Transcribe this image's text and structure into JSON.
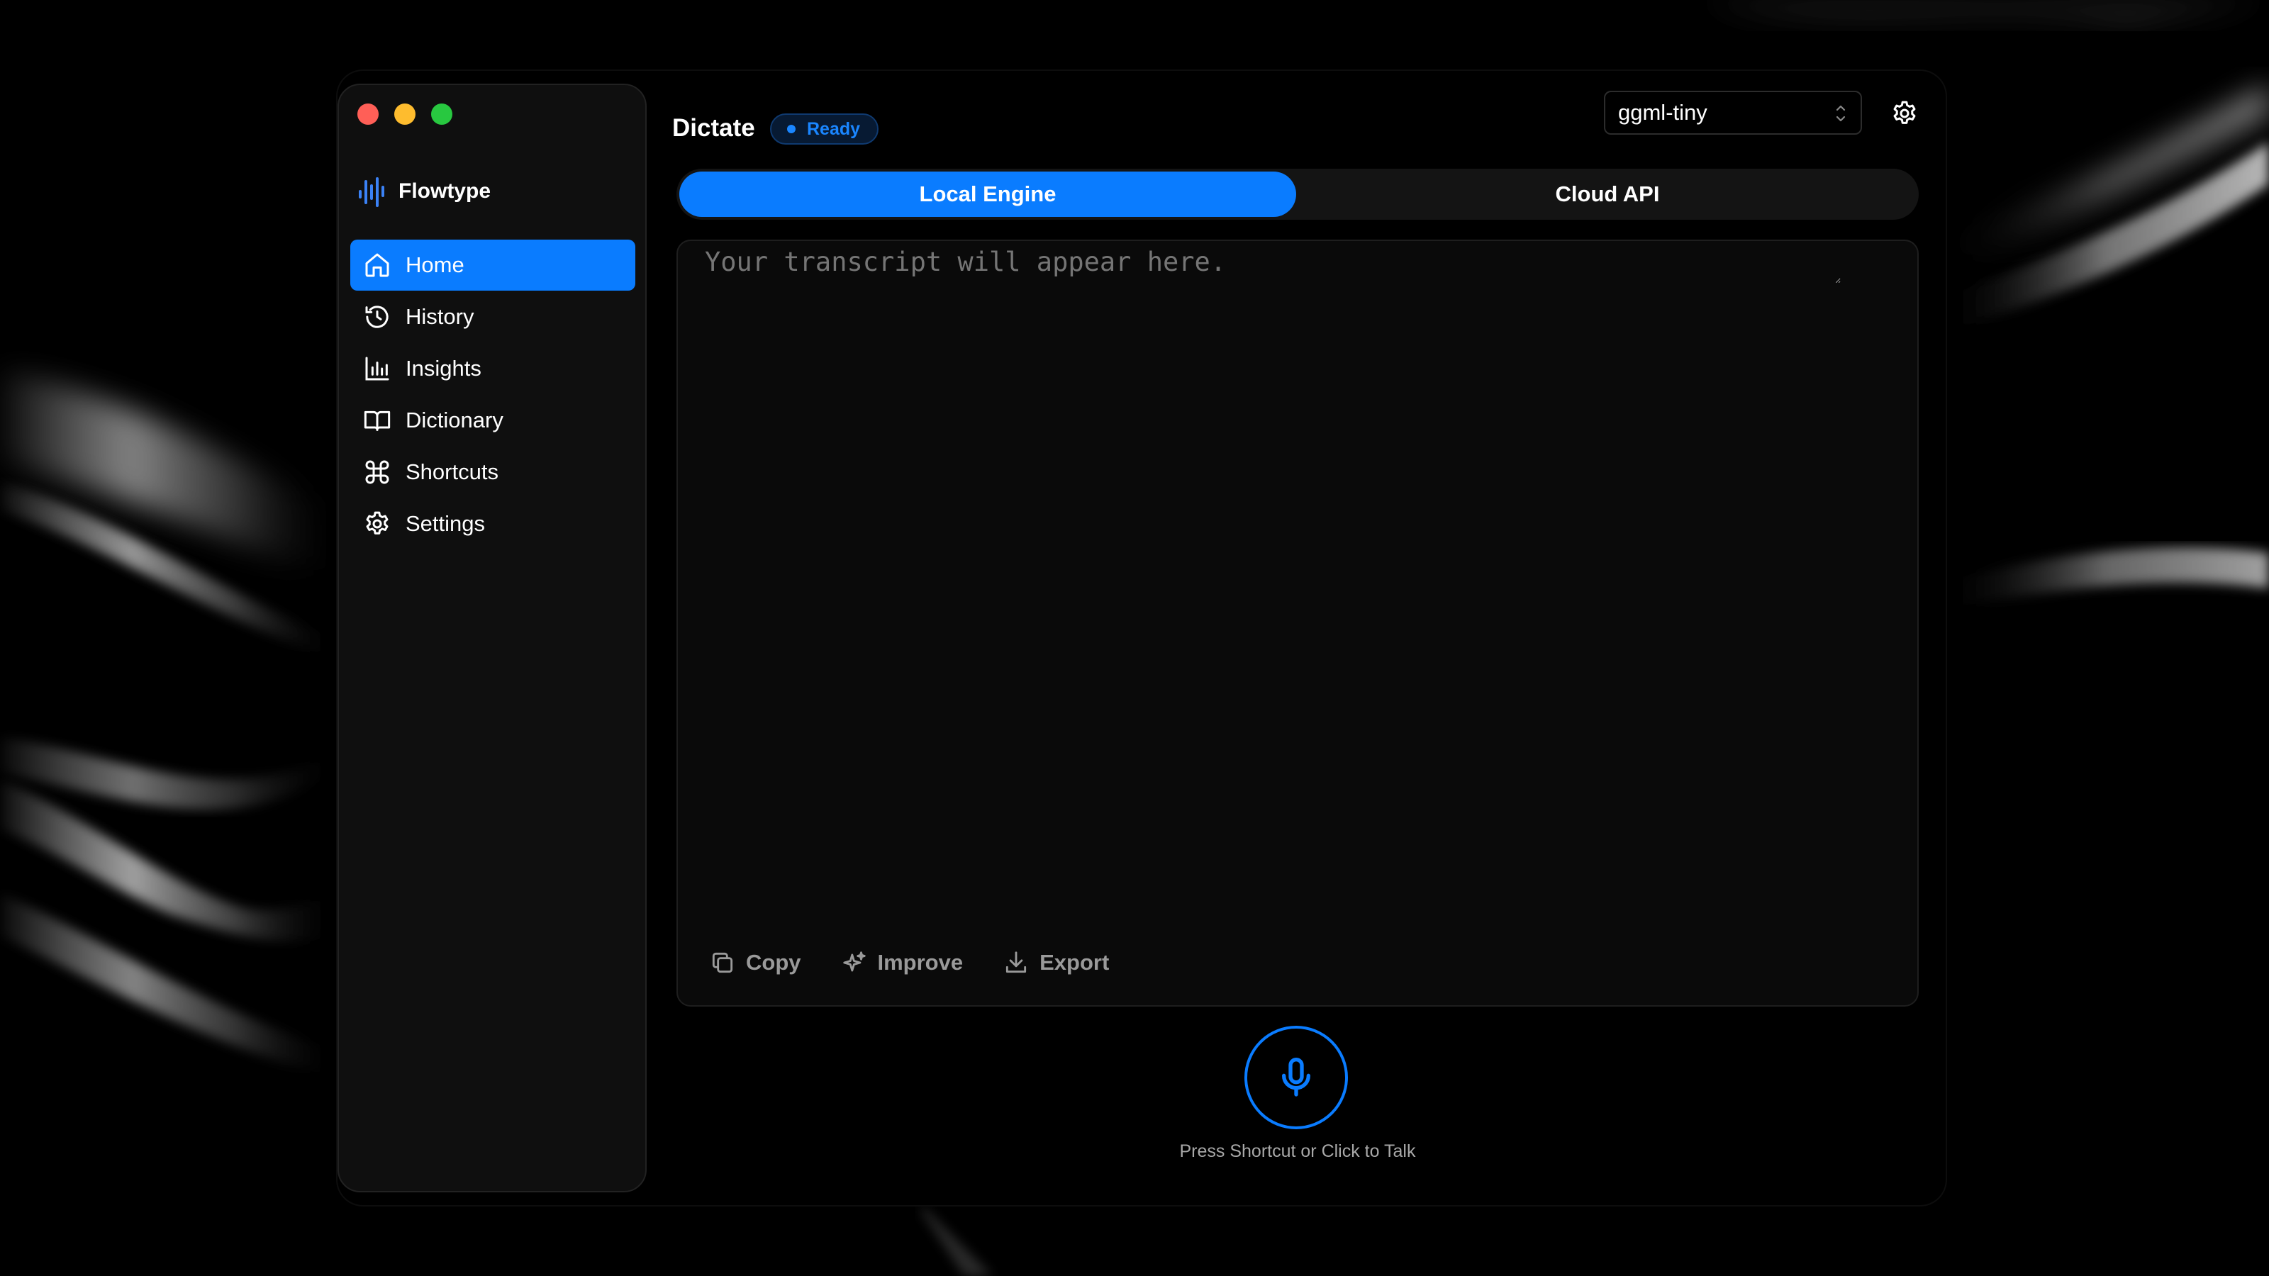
{
  "window": {
    "traffic_lights": {
      "close_color": "#ff5f57",
      "minimize_color": "#febc2e",
      "zoom_color": "#28c840"
    }
  },
  "sidebar": {
    "brand": {
      "name": "Flowtype",
      "icon": "waveform-icon"
    },
    "items": [
      {
        "label": "Home",
        "icon": "home-icon",
        "active": true
      },
      {
        "label": "History",
        "icon": "history-icon",
        "active": false
      },
      {
        "label": "Insights",
        "icon": "bar-chart-icon",
        "active": false
      },
      {
        "label": "Dictionary",
        "icon": "book-icon",
        "active": false
      },
      {
        "label": "Shortcuts",
        "icon": "command-icon",
        "active": false
      },
      {
        "label": "Settings",
        "icon": "gear-icon",
        "active": false
      }
    ]
  },
  "header": {
    "title": "Dictate",
    "status": "Ready",
    "model_select": {
      "value": "ggml-tiny"
    },
    "settings_icon": "gear-icon"
  },
  "engine_tabs": [
    {
      "label": "Local Engine",
      "selected": true
    },
    {
      "label": "Cloud API",
      "selected": false
    }
  ],
  "transcript": {
    "placeholder": "Your transcript will appear here.",
    "value": ""
  },
  "actions": [
    {
      "label": "Copy",
      "icon": "copy-icon"
    },
    {
      "label": "Improve",
      "icon": "sparkles-icon"
    },
    {
      "label": "Export",
      "icon": "download-icon"
    }
  ],
  "mic": {
    "icon": "microphone-icon",
    "hint": "Press Shortcut or Click to Talk"
  },
  "colors": {
    "accent": "#0a7cff",
    "background": "#000000",
    "sidebar_bg": "#0f0f0f",
    "status_text": "#1a86ff"
  }
}
